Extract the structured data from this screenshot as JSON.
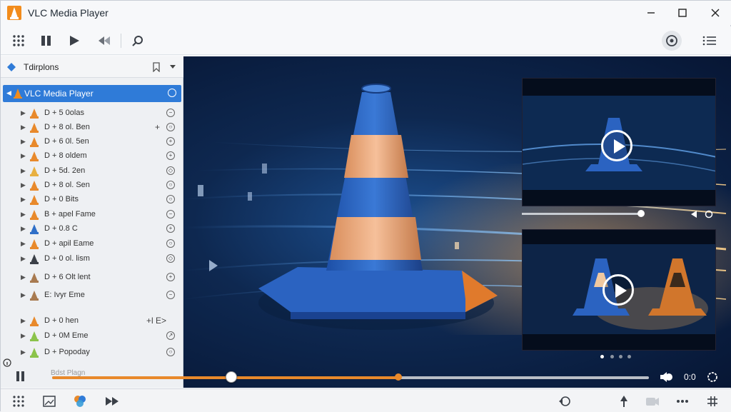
{
  "window": {
    "title": "VLC Media Player",
    "minimize_icon": "minimize-icon",
    "maximize_icon": "maximize-icon",
    "close_icon": "close-icon"
  },
  "toolbar": {
    "icons": [
      "grid-icon",
      "pause-icon",
      "play-icon",
      "skip-back-icon",
      "search-icon",
      "network-icon",
      "menu-icon"
    ]
  },
  "sidebar": {
    "header_label": "Tdirplons",
    "root_label": "VLC Media Player",
    "items": [
      {
        "label": "D + 5 0olas",
        "extra": ""
      },
      {
        "label": "D + 8 ol. Ben",
        "extra": "+"
      },
      {
        "label": "D + 6 0l. 5en",
        "extra": ""
      },
      {
        "label": "D + 8 oldem",
        "extra": ""
      },
      {
        "label": "D + 5d. 2en",
        "extra": ""
      },
      {
        "label": "D + 8 ol. Sen",
        "extra": ""
      },
      {
        "label": "D + 0 Bits",
        "extra": ""
      },
      {
        "label": "B + apel Fame",
        "extra": ""
      },
      {
        "label": "D + 0.8 C",
        "extra": ""
      },
      {
        "label": "D + apil Eame",
        "extra": ""
      },
      {
        "label": "D + 0 ol. lism",
        "extra": ""
      },
      {
        "label": "D + 6 Olt lent",
        "extra": ""
      },
      {
        "label": "E: Ivyr Eme",
        "extra": ""
      },
      {
        "label": "D + 0 hen",
        "extra": "+l E>"
      },
      {
        "label": "D + 0M Eme",
        "extra": ""
      },
      {
        "label": "D + Popoday",
        "extra": ""
      }
    ]
  },
  "player": {
    "mini_label": "Bdst Plagn",
    "time": "0:0",
    "progress": 0.3,
    "buffer_marker": 0.58
  },
  "colors": {
    "accent": "#e8892b",
    "selection": "#2f7bd8",
    "cone_blue": "#2f6fc8",
    "cone_orange": "#f0a060"
  }
}
